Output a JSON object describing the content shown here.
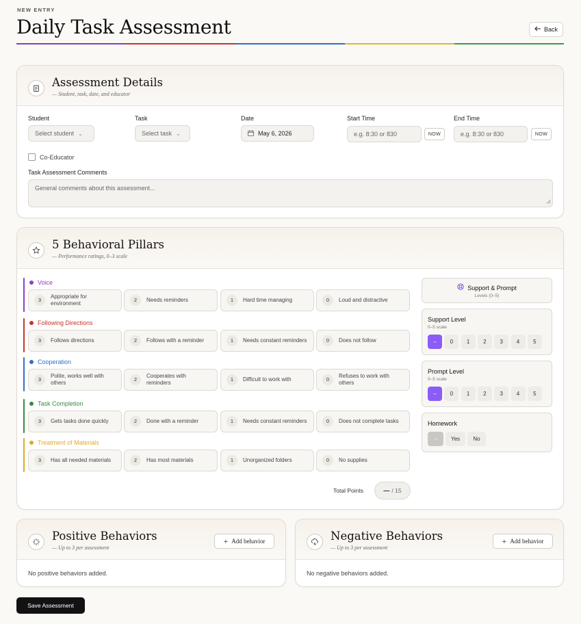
{
  "header": {
    "eyebrow": "NEW ENTRY",
    "title": "Daily Task Assessment",
    "back_label": "Back",
    "rainbow_colors": [
      "#7e3fbf",
      "#c8332b",
      "#2f6fc4",
      "#e4b42c",
      "#3a9a46"
    ]
  },
  "details": {
    "title": "Assessment Details",
    "subtitle": "— Student, task, date, and educator",
    "student_label": "Student",
    "student_value": "Select student",
    "task_label": "Task",
    "task_value": "Select task",
    "date_label": "Date",
    "date_value": "May 6, 2026",
    "start_label": "Start Time",
    "start_placeholder": "e.g. 8:30 or 830",
    "end_label": "End Time",
    "end_placeholder": "e.g. 8:30 or 830",
    "now_label": "NOW",
    "coeducator_label": "Co-Educator",
    "comments_label": "Task Assessment Comments",
    "comments_placeholder": "General comments about this assessment..."
  },
  "pillars": {
    "title": "5 Behavioral Pillars",
    "subtitle": "— Performance ratings, 0–3 scale",
    "items": [
      {
        "name": "Voice",
        "color": "#8b3fc4",
        "options": [
          {
            "n": "3",
            "text": "Appropriate for environment"
          },
          {
            "n": "2",
            "text": "Needs reminders"
          },
          {
            "n": "1",
            "text": "Hard time managing"
          },
          {
            "n": "0",
            "text": "Loud and distractive"
          }
        ]
      },
      {
        "name": "Following Directions",
        "color": "#c8332b",
        "options": [
          {
            "n": "3",
            "text": "Follows directions"
          },
          {
            "n": "2",
            "text": "Follows with a reminder"
          },
          {
            "n": "1",
            "text": "Needs constant reminders"
          },
          {
            "n": "0",
            "text": "Does not follow"
          }
        ]
      },
      {
        "name": "Cooperation",
        "color": "#2f6fc4",
        "options": [
          {
            "n": "3",
            "text": "Polite, works well with others"
          },
          {
            "n": "2",
            "text": "Cooperates with reminders"
          },
          {
            "n": "1",
            "text": "Difficult to work with"
          },
          {
            "n": "0",
            "text": "Refuses to work with others"
          }
        ]
      },
      {
        "name": "Task Completion",
        "color": "#3a8a40",
        "options": [
          {
            "n": "3",
            "text": "Gets tasks done quickly"
          },
          {
            "n": "2",
            "text": "Done with a reminder"
          },
          {
            "n": "1",
            "text": "Needs constant reminders"
          },
          {
            "n": "0",
            "text": "Does not complete tasks"
          }
        ]
      },
      {
        "name": "Treatment of Materials",
        "color": "#e0a82a",
        "options": [
          {
            "n": "3",
            "text": "Has all needed materials"
          },
          {
            "n": "2",
            "text": "Has most materials"
          },
          {
            "n": "1",
            "text": "Unorganized folders"
          },
          {
            "n": "0",
            "text": "No supplies"
          }
        ]
      }
    ],
    "total_label": "Total Points",
    "total_value": "—",
    "total_max": "/ 15"
  },
  "support": {
    "title": "Support & Prompt",
    "subtitle": "Levels (0–5)",
    "support_label": "Support Level",
    "support_scale": "0–5 scale",
    "prompt_label": "Prompt Level",
    "prompt_scale": "0–5 scale",
    "levels": [
      "–",
      "0",
      "1",
      "2",
      "3",
      "4",
      "5"
    ],
    "selected_color": "#8b5cf6",
    "homework_label": "Homework",
    "homework_options": [
      "–",
      "Yes",
      "No"
    ]
  },
  "positive": {
    "title": "Positive Behaviors",
    "subtitle": "— Up to 3 per assessment",
    "add_label": "Add behavior",
    "empty": "No positive behaviors added."
  },
  "negative": {
    "title": "Negative Behaviors",
    "subtitle": "— Up to 3 per assessment",
    "add_label": "Add behavior",
    "empty": "No negative behaviors added."
  },
  "save_label": "Save Assessment"
}
